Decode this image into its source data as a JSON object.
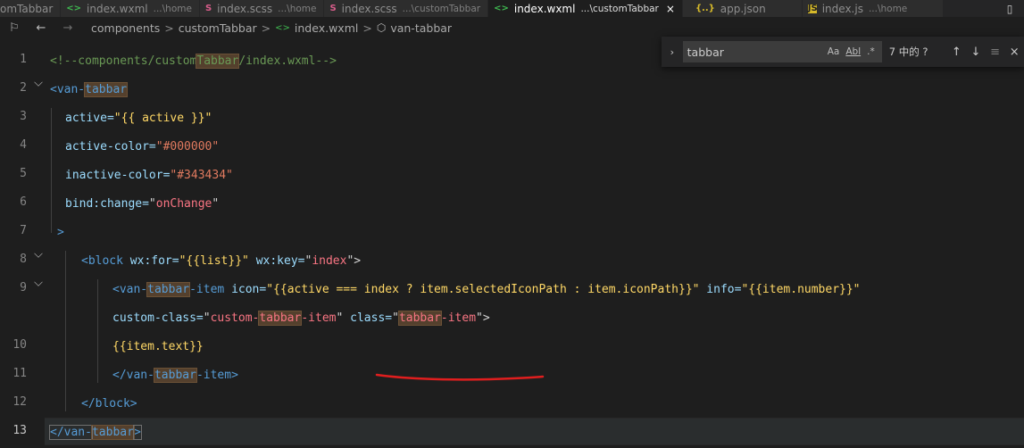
{
  "tabs": [
    {
      "icon": "",
      "name": "omTabbar",
      "desc": "",
      "active": false
    },
    {
      "icon": "<>",
      "name": "index.wxml",
      "desc": "...\\home",
      "active": false
    },
    {
      "icon": "S",
      "name": "index.scss",
      "desc": "...\\home",
      "active": false
    },
    {
      "icon": "S",
      "name": "index.scss",
      "desc": "...\\customTabbar",
      "active": false
    },
    {
      "icon": "<>",
      "name": "index.wxml",
      "desc": "...\\customTabbar",
      "active": true,
      "close": "×"
    },
    {
      "icon": "{..}",
      "name": "app.json",
      "desc": "",
      "active": false
    },
    {
      "icon": "JS",
      "name": "index.js",
      "desc": "...\\home",
      "active": false
    }
  ],
  "breadcrumb": {
    "items": [
      "components",
      "customTabbar",
      "index.wxml",
      "van-tabbar"
    ],
    "separator": ">"
  },
  "find_widget": {
    "query": "tabbar",
    "match_case": "Aa",
    "whole_word": "Abl",
    "regex": ".*",
    "result_count": "7 中的 ?",
    "prev": "↑",
    "next": "↓",
    "close": "×"
  },
  "editor": {
    "line_numbers": [
      "1",
      "2",
      "3",
      "4",
      "5",
      "6",
      "7",
      "8",
      "9",
      "10",
      "11",
      "12",
      "13"
    ],
    "current_line": "13",
    "lines": {
      "l1a": "<!--components/custom",
      "l1b": "Tabbar",
      "l1c": "/index.wxml-->",
      "l2a": "<van-",
      "l2b": "tabbar",
      "l3a": "active=",
      "l3b": "\"{{ active }}\"",
      "l4a": "active-color=",
      "l4b": "\"#000000\"",
      "l5a": "inactive-color=",
      "l5b": "\"#343434\"",
      "l6a": "bind:change=",
      "l6b": "\"",
      "l6c": "onChange",
      "l6d": "\"",
      "l7a": ">",
      "l8a": "<block ",
      "l8b": "wx:for=",
      "l8c": "\"{{list}}\"",
      "l8d": " wx:key=",
      "l8e": "\"",
      "l8f": "index",
      "l8g": "\">",
      "l9a": "<van-",
      "l9b": "tabbar",
      "l9c": "-item ",
      "l9d": "icon=",
      "l9e": "\"{{active === index ? item.selectedIconPath : item.iconPath}}\"",
      "l9f": " info=",
      "l9g": "\"{{item.number}}\"",
      "l9wa": "custom-class=",
      "l9wb": "\"",
      "l9wc": "custom-",
      "l9wd": "tabbar",
      "l9we": "-item",
      "l9wf": "\"",
      "l9wg": " class=",
      "l9wh": "\"",
      "l9wi": "tabbar",
      "l9wj": "-item",
      "l9wk": "\">",
      "l10a": "{{item.text}}",
      "l11a": "</van-",
      "l11b": "tabbar",
      "l11c": "-item>",
      "l12a": "</block>",
      "l13a": "</van-",
      "l13b": "tabbar",
      "l13c": ">"
    }
  },
  "colors": {
    "editor_bg": "#1e1e1e",
    "annotation": "#e01e1e",
    "match_highlight": "#54402d"
  }
}
